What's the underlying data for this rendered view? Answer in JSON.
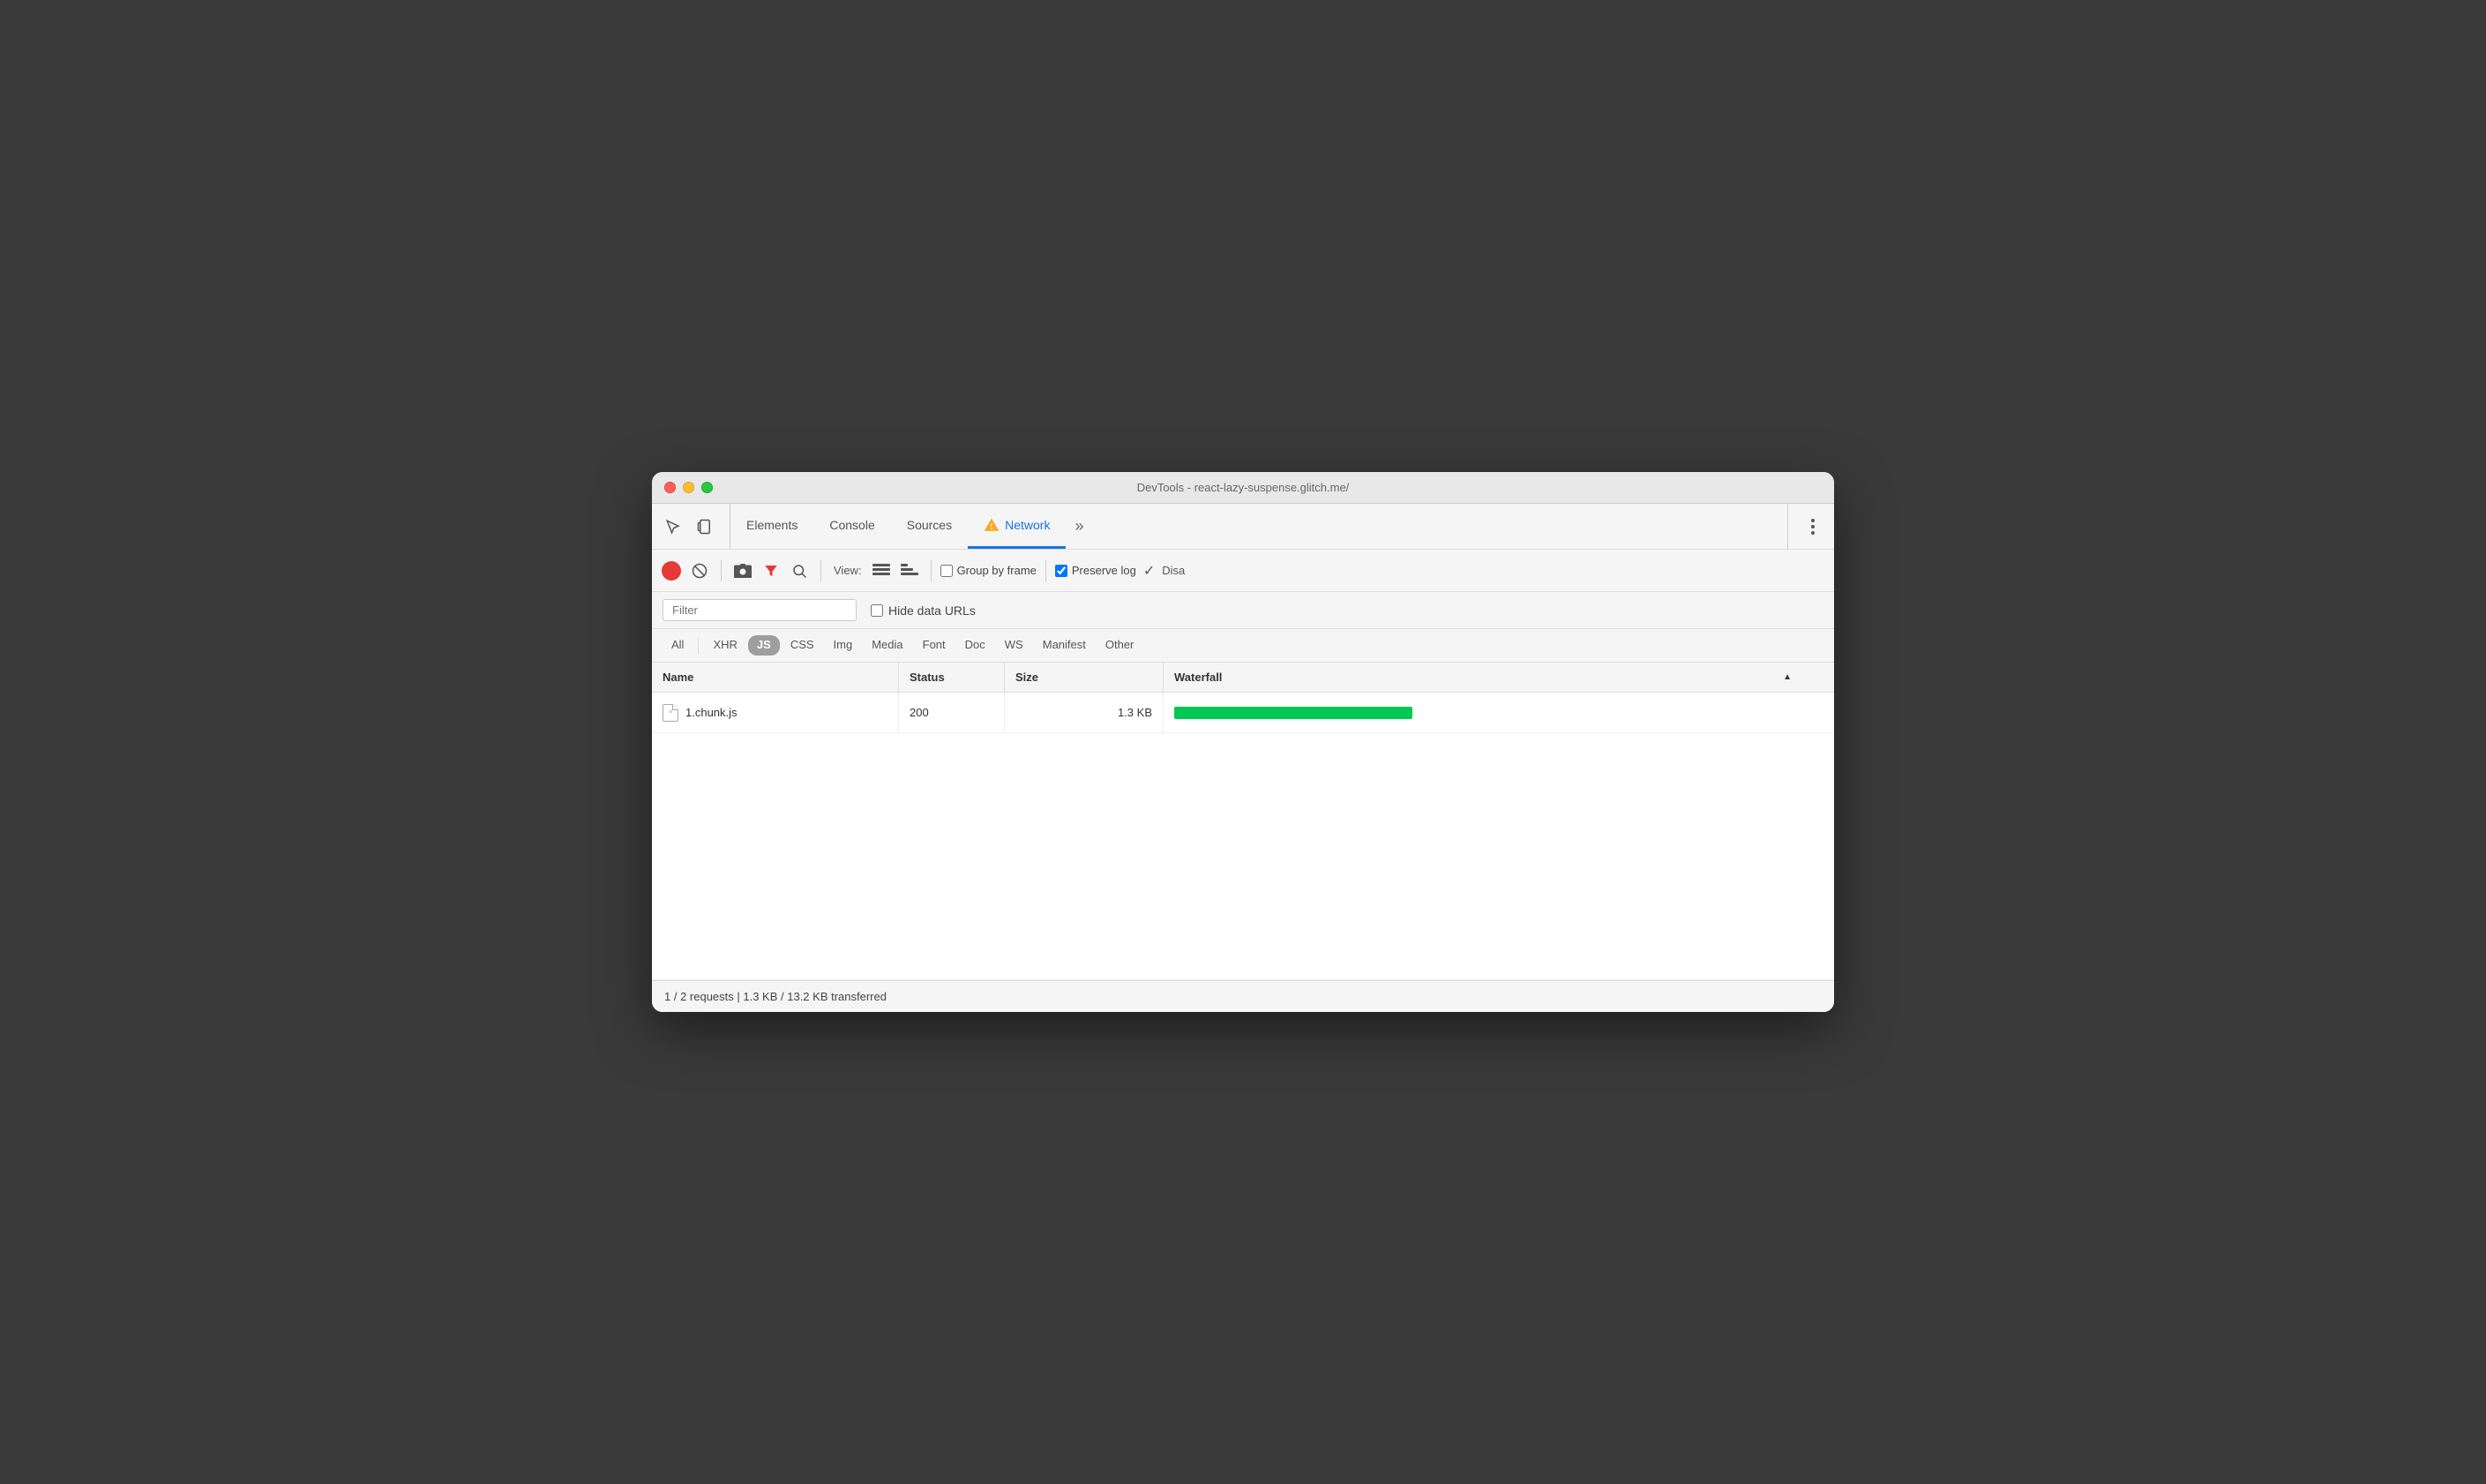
{
  "window": {
    "title": "DevTools - react-lazy-suspense.glitch.me/"
  },
  "tabs": {
    "items": [
      {
        "id": "elements",
        "label": "Elements",
        "active": false
      },
      {
        "id": "console",
        "label": "Console",
        "active": false
      },
      {
        "id": "sources",
        "label": "Sources",
        "active": false
      },
      {
        "id": "network",
        "label": "Network",
        "active": true
      },
      {
        "id": "more",
        "label": "»",
        "active": false
      }
    ]
  },
  "toolbar": {
    "record_title": "Record network log",
    "clear_title": "Clear",
    "filter_title": "Filter",
    "search_title": "Search",
    "view_label": "View:",
    "group_by_frame_label": "Group by frame",
    "preserve_log_label": "Preserve log",
    "disable_cache_label": "Disa",
    "group_by_frame_checked": false,
    "preserve_log_checked": true,
    "disable_cache_checked": false
  },
  "filter": {
    "placeholder": "Filter",
    "hide_data_urls_label": "Hide data URLs",
    "hide_data_urls_checked": false
  },
  "type_filters": {
    "items": [
      {
        "id": "all",
        "label": "All",
        "active": false
      },
      {
        "id": "xhr",
        "label": "XHR",
        "active": false
      },
      {
        "id": "js",
        "label": "JS",
        "active": true
      },
      {
        "id": "css",
        "label": "CSS",
        "active": false
      },
      {
        "id": "img",
        "label": "Img",
        "active": false
      },
      {
        "id": "media",
        "label": "Media",
        "active": false
      },
      {
        "id": "font",
        "label": "Font",
        "active": false
      },
      {
        "id": "doc",
        "label": "Doc",
        "active": false
      },
      {
        "id": "ws",
        "label": "WS",
        "active": false
      },
      {
        "id": "manifest",
        "label": "Manifest",
        "active": false
      },
      {
        "id": "other",
        "label": "Other",
        "active": false
      }
    ]
  },
  "table": {
    "columns": [
      {
        "id": "name",
        "label": "Name"
      },
      {
        "id": "status",
        "label": "Status"
      },
      {
        "id": "size",
        "label": "Size"
      },
      {
        "id": "waterfall",
        "label": "Waterfall"
      }
    ],
    "rows": [
      {
        "name": "1.chunk.js",
        "status": "200",
        "size": "1.3 KB",
        "waterfall_offset": 0,
        "waterfall_width": 270
      }
    ]
  },
  "status_bar": {
    "text": "1 / 2 requests | 1.3 KB / 13.2 KB transferred"
  },
  "colors": {
    "active_tab": "#1a73e8",
    "record_red": "#e53935",
    "waterfall_green": "#00c853",
    "js_badge_bg": "#9e9e9e",
    "js_badge_text": "#ffffff"
  }
}
